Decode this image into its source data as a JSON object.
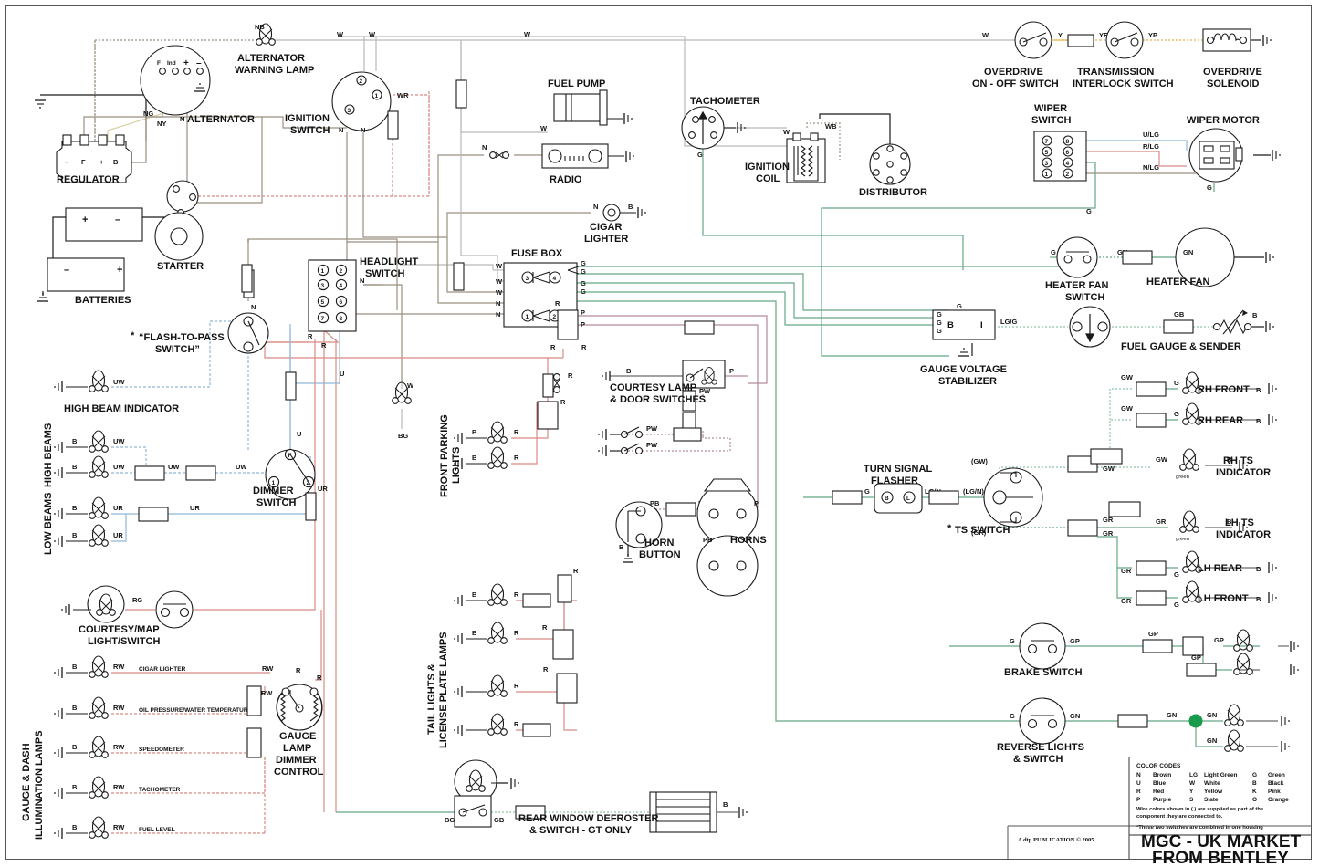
{
  "titleBlock": {
    "line1": "MGC - UK MARKET",
    "line2": "FROM BENTLEY",
    "publisher": "A dtp PUBLICATION  © 2005"
  },
  "colorCodes": {
    "heading": "COLOR CODES",
    "rows": [
      {
        "c1": "N",
        "n1": "Brown",
        "c2": "LG",
        "n2": "Light Green",
        "c3": "G",
        "n3": "Green"
      },
      {
        "c1": "U",
        "n1": "Blue",
        "c2": "W",
        "n2": "White",
        "c3": "B",
        "n3": "Black"
      },
      {
        "c1": "R",
        "n1": "Red",
        "c2": "Y",
        "n2": "Yellow",
        "c3": "K",
        "n3": "Pink"
      },
      {
        "c1": "P",
        "n1": "Purple",
        "c2": "S",
        "n2": "Slate",
        "c3": "O",
        "n3": "Orange"
      }
    ],
    "note1": "Wire colors shown in ( ) are supplied as part of the",
    "note2": "component they are connected to.",
    "note3": "*These two switches are combined in one housing"
  },
  "components": {
    "alternator_warning_lamp": "ALTERNATOR\nWARNING LAMP",
    "alternator_warning_lamp_l1": "ALTERNATOR",
    "alternator_warning_lamp_l2": "WARNING LAMP",
    "alternator": "ALTERNATOR",
    "alternator_terms": [
      "F",
      "Ind",
      "+",
      "–"
    ],
    "regulator": "REGULATOR",
    "regulator_terms": [
      "–",
      "F",
      "+",
      "B+"
    ],
    "batteries": "BATTERIES",
    "starter": "STARTER",
    "ignition_switch_l1": "IGNITION",
    "ignition_switch_l2": "SWITCH",
    "ignition_switch_terms": [
      "1",
      "2",
      "3"
    ],
    "fuel_pump": "FUEL PUMP",
    "radio": "RADIO",
    "cigar_lighter_l1": "CIGAR",
    "cigar_lighter_l2": "LIGHTER",
    "tachometer": "TACHOMETER",
    "ignition_coil_l1": "IGNITION",
    "ignition_coil_l2": "COIL",
    "distributor": "DISTRIBUTOR",
    "overdrive_switch_l1": "OVERDRIVE",
    "overdrive_switch_l2": "ON - OFF SWITCH",
    "transmission_interlock_l1": "TRANSMISSION",
    "transmission_interlock_l2": "INTERLOCK SWITCH",
    "overdrive_solenoid_l1": "OVERDRIVE",
    "overdrive_solenoid_l2": "SOLENOID",
    "wiper_switch_l1": "WIPER",
    "wiper_switch_l2": "SWITCH",
    "wiper_switch_terms": [
      "7",
      "8",
      "5",
      "6",
      "3",
      "4",
      "1",
      "2"
    ],
    "wiper_motor": "WIPER MOTOR",
    "heater_fan_switch_l1": "HEATER FAN",
    "heater_fan_switch_l2": "SWITCH",
    "heater_fan": "HEATER FAN",
    "gauge_voltage_stabilizer_l1": "GAUGE VOLTAGE",
    "gauge_voltage_stabilizer_l2": "STABILIZER",
    "gvs_terms": [
      "B",
      "I"
    ],
    "fuel_gauge_sender": "FUEL GAUGE & SENDER",
    "headlight_switch_l1": "HEADLIGHT",
    "headlight_switch_l2": "SWITCH",
    "headlight_switch_terms": [
      "1",
      "2",
      "3",
      "4",
      "5",
      "6",
      "7",
      "8"
    ],
    "fuse_box": "FUSE BOX",
    "fuse_nums": [
      "3",
      "4",
      "1",
      "2"
    ],
    "flash_to_pass_l1": "“FLASH-TO-PASS",
    "flash_to_pass_l2": "SWITCH”",
    "flash_to_pass_star": "*",
    "high_beam_indicator": "HIGH BEAM INDICATOR",
    "high_beams": "HIGH BEAMS",
    "low_beams": "LOW BEAMS",
    "dimmer_switch_l1": "DIMMER",
    "dimmer_switch_l2": "SWITCH",
    "dimmer_terms": [
      "F",
      "1",
      "2"
    ],
    "courtesy_map_l1": "COURTESY/MAP",
    "courtesy_map_l2": "LIGHT/SWITCH",
    "gauge_dash_l1": "GAUGE & DASH",
    "gauge_dash_l2": "ILLUMINATION LAMPS",
    "dash_lamps": [
      "CIGAR LIGHTER",
      "OIL PRESSURE/WATER TEMPERATURE",
      "SPEEDOMETER",
      "TACHOMETER",
      "FUEL LEVEL"
    ],
    "gauge_lamp_dimmer": [
      "GAUGE",
      "LAMP",
      "DIMMER",
      "CONTROL"
    ],
    "front_parking_l1": "FRONT PARKING",
    "front_parking_l2": "LIGHTS",
    "tail_lights_l1": "TAIL LIGHTS &",
    "tail_lights_l2": "LICENSE PLATE LAMPS",
    "courtesy_lamp_l1": "COURTESY LAMP",
    "courtesy_lamp_l2": "& DOOR SWITCHES",
    "horn_button_l1": "HORN",
    "horn_button_l2": "BUTTON",
    "horns": "HORNS",
    "turn_signal_flasher_l1": "TURN SIGNAL",
    "turn_signal_flasher_l2": "FLASHER",
    "flasher_terms": [
      "B",
      "L"
    ],
    "ts_switch": "TS SWITCH",
    "ts_switch_star": "*",
    "rh_front": "RH FRONT",
    "rh_rear": "RH REAR",
    "rh_ts_l1": "RH TS",
    "rh_ts_l2": "INDICATOR",
    "lh_ts_l1": "LH TS",
    "lh_ts_l2": "INDICATOR",
    "lh_rear": "LH REAR",
    "lh_front": "LH FRONT",
    "green_note": "green",
    "brake_switch": "BRAKE SWITCH",
    "reverse_lights_l1": "REVERSE LIGHTS",
    "reverse_lights_l2": "& SWITCH",
    "rear_defroster_l1": "REAR WINDOW DEFROSTER",
    "rear_defroster_l2": "& SWITCH - GT ONLY"
  },
  "wireLabels": {
    "NB": "NB",
    "W": "W",
    "NG": "NG",
    "NY": "NY",
    "N": "N",
    "WR": "WR",
    "Y": "Y",
    "YR": "YR",
    "YP": "YP",
    "ULG": "U/LG",
    "RLG": "R/LG",
    "NLG": "N/LG",
    "G": "G",
    "WB": "WB",
    "B": "B",
    "GN": "GN",
    "P": "P",
    "PW": "PW",
    "PB": "PB",
    "R": "R",
    "U": "U",
    "UW": "UW",
    "UR": "UR",
    "RW": "RW",
    "RG": "RG",
    "BG": "BG",
    "GB": "GB",
    "GW": "GW",
    "GR": "GR",
    "GP": "GP",
    "LGG": "LG/G",
    "LGN": "LG/N",
    "LGNp": "(LG/N)",
    "GWp": "(GW)",
    "GRp": "(GR)"
  },
  "colors": {
    "brown": "#9a8f80",
    "white": "#b9b9b9",
    "red": "#d98b84",
    "blue": "#8fb8d8",
    "green": "#63a883",
    "yellow": "#e8b04a",
    "purple": "#b5899f",
    "black": "#6b6b6b",
    "lightgreen": "#8fc4a4",
    "dot": "#1a9a4b"
  }
}
